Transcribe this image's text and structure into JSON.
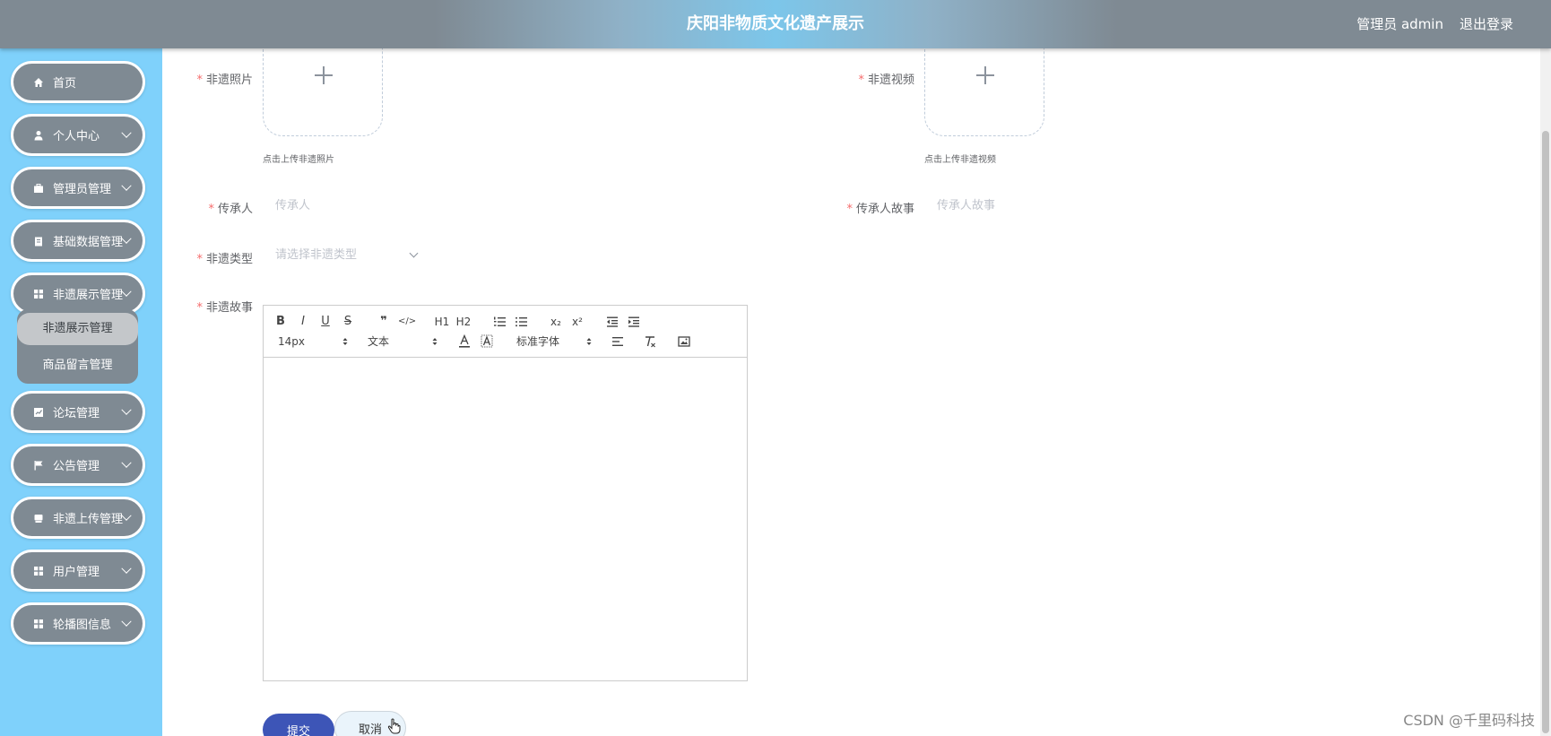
{
  "header": {
    "title": "庆阳非物质文化遗产展示",
    "user": "管理员 admin",
    "logout": "退出登录"
  },
  "sidebar": {
    "items": [
      {
        "label": "首页",
        "icon": "home-icon"
      },
      {
        "label": "个人中心",
        "icon": "user-icon"
      },
      {
        "label": "管理员管理",
        "icon": "briefcase-icon"
      },
      {
        "label": "基础数据管理",
        "icon": "clipboard-icon"
      },
      {
        "label": "非遗展示管理",
        "icon": "grid-icon"
      },
      {
        "label": "论坛管理",
        "icon": "chart-icon"
      },
      {
        "label": "公告管理",
        "icon": "flag-icon"
      },
      {
        "label": "非遗上传管理",
        "icon": "box-icon"
      },
      {
        "label": "用户管理",
        "icon": "grid-icon"
      },
      {
        "label": "轮播图信息",
        "icon": "grid-icon"
      }
    ],
    "submenu": [
      {
        "label": "非遗展示管理",
        "active": true
      },
      {
        "label": "商品留言管理",
        "active": false
      }
    ]
  },
  "form": {
    "photo": {
      "label": "非遗照片",
      "tip": "点击上传非遗照片"
    },
    "video": {
      "label": "非遗视频",
      "tip": "点击上传非遗视频"
    },
    "inheritor": {
      "label": "传承人",
      "placeholder": "传承人"
    },
    "inheritor_story": {
      "label": "传承人故事",
      "placeholder": "传承人故事"
    },
    "type": {
      "label": "非遗类型",
      "placeholder": "请选择非遗类型"
    },
    "story": {
      "label": "非遗故事"
    },
    "required_mark": "*"
  },
  "editor": {
    "toolbar_row1": [
      "B",
      "I",
      "U",
      "S",
      "❞",
      "</>",
      "H1",
      "H2",
      "ol",
      "ul",
      "x₂",
      "x²",
      "outdent",
      "indent"
    ],
    "font_size": "14px",
    "header_type": "文本",
    "font_family": "标准字体"
  },
  "buttons": {
    "submit": "提交",
    "cancel": "取消"
  },
  "watermark": "CSDN @千里码科技"
}
